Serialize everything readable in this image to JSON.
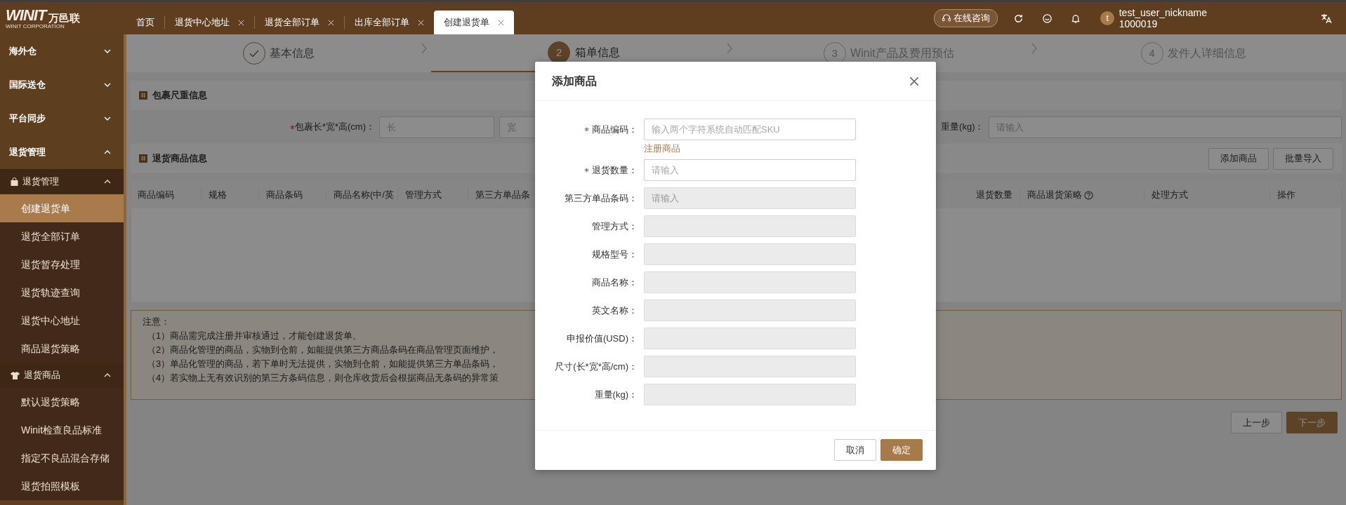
{
  "topbar": {
    "logo": {
      "mark": "WINIT",
      "name": "万邑联",
      "tagline": "WINIT CORPORATION"
    },
    "tabs": [
      {
        "label": "首页",
        "closable": false,
        "selected": false
      },
      {
        "label": "退货中心地址",
        "closable": true,
        "selected": false
      },
      {
        "label": "退货全部订单",
        "closable": true,
        "selected": false
      },
      {
        "label": "出库全部订单",
        "closable": true,
        "selected": false
      },
      {
        "label": "创建退货单",
        "closable": true,
        "selected": true
      }
    ],
    "consult": "在线咨询",
    "user": {
      "avatar": "t",
      "name": "test_user_nickname",
      "id": "1000019"
    }
  },
  "sidebar": {
    "items": [
      {
        "label": "海外仓",
        "expanded": false
      },
      {
        "label": "国际送仓",
        "expanded": false
      },
      {
        "label": "平台同步",
        "expanded": false
      },
      {
        "label": "退货管理",
        "expanded": true,
        "children": [
          {
            "label": "退货管理",
            "kind": "bag",
            "expanded": true,
            "children": [
              {
                "label": "创建退货单",
                "selected": true
              },
              {
                "label": "退货全部订单",
                "selected": false
              },
              {
                "label": "退货暂存处理",
                "selected": false
              },
              {
                "label": "退货轨迹查询",
                "selected": false
              },
              {
                "label": "退货中心地址",
                "selected": false
              },
              {
                "label": "商品退货策略",
                "selected": false
              }
            ]
          },
          {
            "label": "退货商品",
            "kind": "shirt",
            "expanded": true,
            "children": [
              {
                "label": "默认退货策略",
                "selected": false
              },
              {
                "label": "Winit检查良品标准",
                "selected": false
              },
              {
                "label": "指定不良品混合存储",
                "selected": false
              },
              {
                "label": "退货拍照模板",
                "selected": false
              }
            ]
          }
        ]
      }
    ]
  },
  "steps": [
    {
      "label": "基本信息",
      "done": true,
      "current": false
    },
    {
      "number": "2",
      "label": "箱单信息",
      "done": false,
      "current": true
    },
    {
      "number": "3",
      "label": "Winit产品及费用预估",
      "done": false,
      "current": false
    },
    {
      "number": "4",
      "label": "发件人详细信息",
      "done": false,
      "current": false
    }
  ],
  "parcel": {
    "title": "包裹尺重信息",
    "size_label": "包裹长*宽*高(cm)：",
    "required": true,
    "size_inputs": [
      {
        "placeholder": "长"
      },
      {
        "placeholder": "宽"
      }
    ],
    "weight_label": "重量(kg)：",
    "weight_input": {
      "placeholder": "请输入"
    }
  },
  "goods": {
    "title": "退货商品信息",
    "buttons": [
      "添加商品",
      "批量导入"
    ],
    "columns_left": [
      {
        "label": "商品编码"
      },
      {
        "label": "规格"
      },
      {
        "label": "商品条码"
      },
      {
        "label": "商品名称(中/英"
      },
      {
        "label": "管理方式"
      },
      {
        "label": "第三方单品条"
      }
    ],
    "columns_right": [
      {
        "label": "退货数量",
        "help": false
      },
      {
        "label": "商品退货策略",
        "help": true
      },
      {
        "label": "处理方式",
        "help": false
      },
      {
        "label": "操作",
        "help": false
      }
    ]
  },
  "notes": {
    "title": "注意：",
    "lines": [
      "（1）商品需完成注册并审核通过，才能创建退货单。",
      "（2）商品化管理的商品，实物到仓前，如能提供第三方商品条码在商品管理页面维护，",
      "（3）单品化管理的商品，若下单时无法提供，实物到仓前，如能提供第三方单品条码，",
      "（4）若实物上无有效识别的第三方条码信息，则仓库收货后会根据商品无条码的异常策"
    ]
  },
  "actions": [
    {
      "label": "上一步",
      "primary": false
    },
    {
      "label": "下一步",
      "primary": true
    }
  ],
  "modal": {
    "title": "添加商品",
    "fields": [
      {
        "label": "商品编码：",
        "required": true,
        "disabled": false,
        "placeholder": "输入两个字符系统自动匹配SKU",
        "link": "注册商品"
      },
      {
        "label": "退货数量：",
        "required": true,
        "disabled": false,
        "placeholder": "请输入"
      },
      {
        "label": "第三方单品条码：",
        "required": false,
        "disabled": true,
        "placeholder": "请输入"
      },
      {
        "label": "管理方式：",
        "required": false,
        "disabled": true
      },
      {
        "label": "规格型号：",
        "required": false,
        "disabled": true
      },
      {
        "label": "商品名称：",
        "required": false,
        "disabled": true
      },
      {
        "label": "英文名称：",
        "required": false,
        "disabled": true
      },
      {
        "label": "申报价值(USD)：",
        "required": false,
        "disabled": true
      },
      {
        "label": "尺寸(长*宽*高/cm)：",
        "required": false,
        "disabled": true
      },
      {
        "label": "重量(kg)：",
        "required": false,
        "disabled": true
      }
    ],
    "buttons": [
      {
        "label": "取消",
        "primary": false
      },
      {
        "label": "确定",
        "primary": true
      }
    ]
  }
}
